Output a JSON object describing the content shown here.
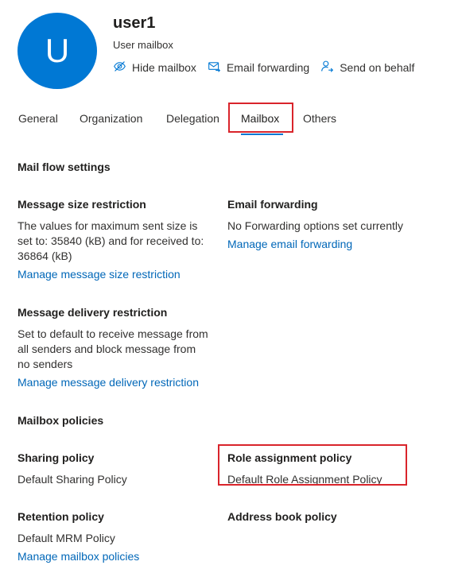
{
  "header": {
    "avatar_initial": "U",
    "user_name": "user1",
    "user_type": "User mailbox",
    "actions": [
      {
        "label": "Hide mailbox",
        "icon": "hide-eye-icon"
      },
      {
        "label": "Email forwarding",
        "icon": "mail-forward-icon"
      },
      {
        "label": "Send on behalf",
        "icon": "person-send-icon"
      }
    ]
  },
  "tabs": [
    "General",
    "Organization",
    "Delegation",
    "Mailbox",
    "Others"
  ],
  "selected_tab": "Mailbox",
  "mail_flow": {
    "heading": "Mail flow settings",
    "message_size": {
      "title": "Message size restriction",
      "lines": [
        "The values for maximum sent size is",
        "set to: 35840 (kB) and for received to:",
        "36864 (kB)"
      ],
      "link": "Manage message size restriction"
    },
    "email_forwarding": {
      "title": "Email forwarding",
      "text": "No Forwarding options set currently",
      "link": "Manage email forwarding"
    },
    "message_delivery": {
      "title": "Message delivery restriction",
      "lines": [
        "Set to default to receive message from",
        "all senders and block message from",
        "no senders"
      ],
      "link": "Manage message delivery restriction"
    }
  },
  "mailbox_policies": {
    "heading": "Mailbox policies",
    "sharing": {
      "title": "Sharing policy",
      "value": "Default Sharing Policy"
    },
    "role_assignment": {
      "title": "Role assignment policy",
      "value": "Default Role Assignment Policy"
    },
    "retention": {
      "title": "Retention policy",
      "value": "Default MRM Policy",
      "link": "Manage mailbox policies"
    },
    "address_book": {
      "title": "Address book policy"
    }
  },
  "colors": {
    "accent": "#0078d4",
    "link": "#0067b8",
    "highlight": "#d9242b"
  }
}
